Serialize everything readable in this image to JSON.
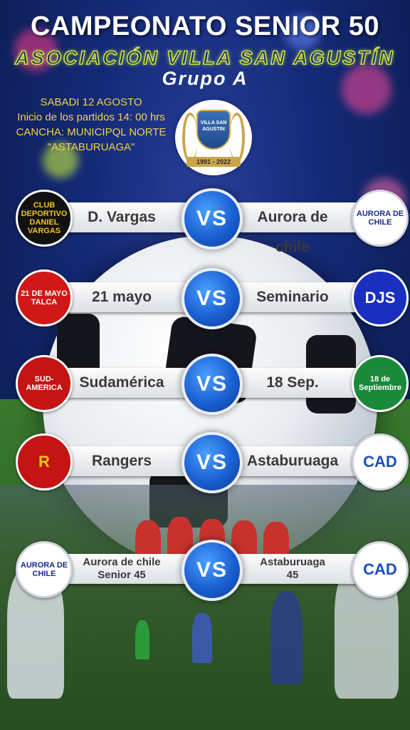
{
  "header": {
    "title": "CAMPEONATO SENIOR 50",
    "association": "Asociación Villa San Agustín",
    "group": "Grupo A"
  },
  "info": {
    "date": "SABADI 12  AGOSTO",
    "start_time": "Inicio de los partidos 14: 00 hrs",
    "field": "CANCHA: MUNICIPQL NORTE",
    "venue": "\"ASTABURUAGA\""
  },
  "crest": {
    "name": "VILLA SAN AGUSTIN",
    "years": "1991 - 2022"
  },
  "vs_label": "VS",
  "matches": [
    {
      "home": "D. Vargas",
      "away": "Aurora de chile",
      "home_logo": {
        "icon": "dvargas-club-icon",
        "bg": "#111111",
        "fg": "#f2c21a",
        "text": "CLUB DEPORTIVO DANIEL VARGAS"
      },
      "away_logo": {
        "icon": "aurora-de-chile-icon",
        "bg": "#ffffff",
        "fg": "#1b2a8a",
        "text": "AURORA DE CHILE"
      }
    },
    {
      "home": "21 mayo",
      "away": "Seminario",
      "home_logo": {
        "icon": "21-de-mayo-icon",
        "bg": "#d01818",
        "fg": "#ffffff",
        "text": "21 DE MAYO TALCA"
      },
      "away_logo": {
        "icon": "djs-seminario-icon",
        "bg": "#1a2fbf",
        "fg": "#ffffff",
        "text": "DJS"
      }
    },
    {
      "home": "Sudamérica",
      "away": "18 Sep.",
      "home_logo": {
        "icon": "sud-america-icon",
        "bg": "#c41414",
        "fg": "#ffffff",
        "text": "SUD-AMERICA"
      },
      "away_logo": {
        "icon": "18-de-septiembre-icon",
        "bg": "#1a8a3a",
        "fg": "#ffffff",
        "text": "18 de Septiembre"
      }
    },
    {
      "home": "Rangers",
      "away": "Astaburuaga",
      "home_logo": {
        "icon": "rangers-icon",
        "bg": "#c41414",
        "fg": "#f2c21a",
        "text": "R"
      },
      "away_logo": {
        "icon": "cad-astaburuaga-icon",
        "bg": "#ffffff",
        "fg": "#1a4fbf",
        "text": "CAD"
      }
    },
    {
      "home": "Aurora de chile\nSenior 45",
      "away": "Astaburuaga\n45",
      "home_logo": {
        "icon": "aurora-de-chile-icon",
        "bg": "#ffffff",
        "fg": "#1b2a8a",
        "text": "AURORA DE CHILE"
      },
      "away_logo": {
        "icon": "cad-astaburuaga-icon",
        "bg": "#ffffff",
        "fg": "#1a4fbf",
        "text": "CAD"
      }
    }
  ]
}
